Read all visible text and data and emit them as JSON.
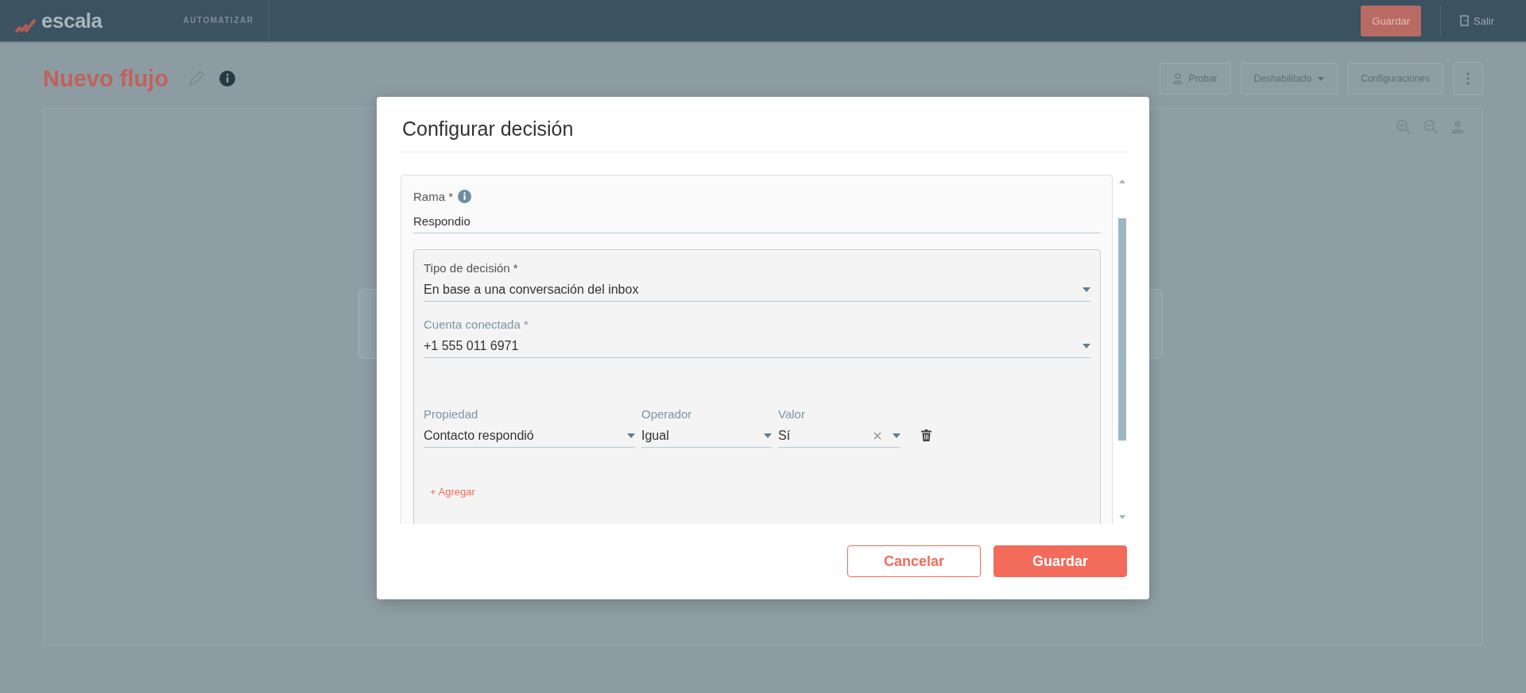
{
  "header": {
    "logo": "escala",
    "nav_item": "AUTOMATIZAR",
    "save_button": "Guardar",
    "logout": "Salir"
  },
  "page": {
    "title": "Nuevo flujo",
    "actions": [
      {
        "label": "Probar",
        "kind": "person"
      },
      {
        "label": "Deshabilitado",
        "kind": "dropdown"
      },
      {
        "label": "Configuraciones",
        "kind": "plain"
      }
    ]
  },
  "modal": {
    "title": "Configurar decisión",
    "branch": {
      "label": "Rama *",
      "value": "Respondio"
    },
    "decision_type": {
      "label": "Tipo de decisión *",
      "value": "En base a una conversación del inbox"
    },
    "account": {
      "label": "Cuenta conectada *",
      "value": "+1 555 011 6971"
    },
    "conditions": [
      {
        "property": {
          "label": "Propiedad",
          "value": "Contacto respondió"
        },
        "operator": {
          "label": "Operador",
          "value": "Igual"
        },
        "value": {
          "label": "Valor",
          "value": "Sí",
          "clearable": true
        }
      }
    ],
    "add_link": "+ Agregar",
    "buttons": [
      {
        "label": "Cancelar",
        "kind": "secondary"
      },
      {
        "label": "Guardar",
        "kind": "primary"
      }
    ]
  }
}
